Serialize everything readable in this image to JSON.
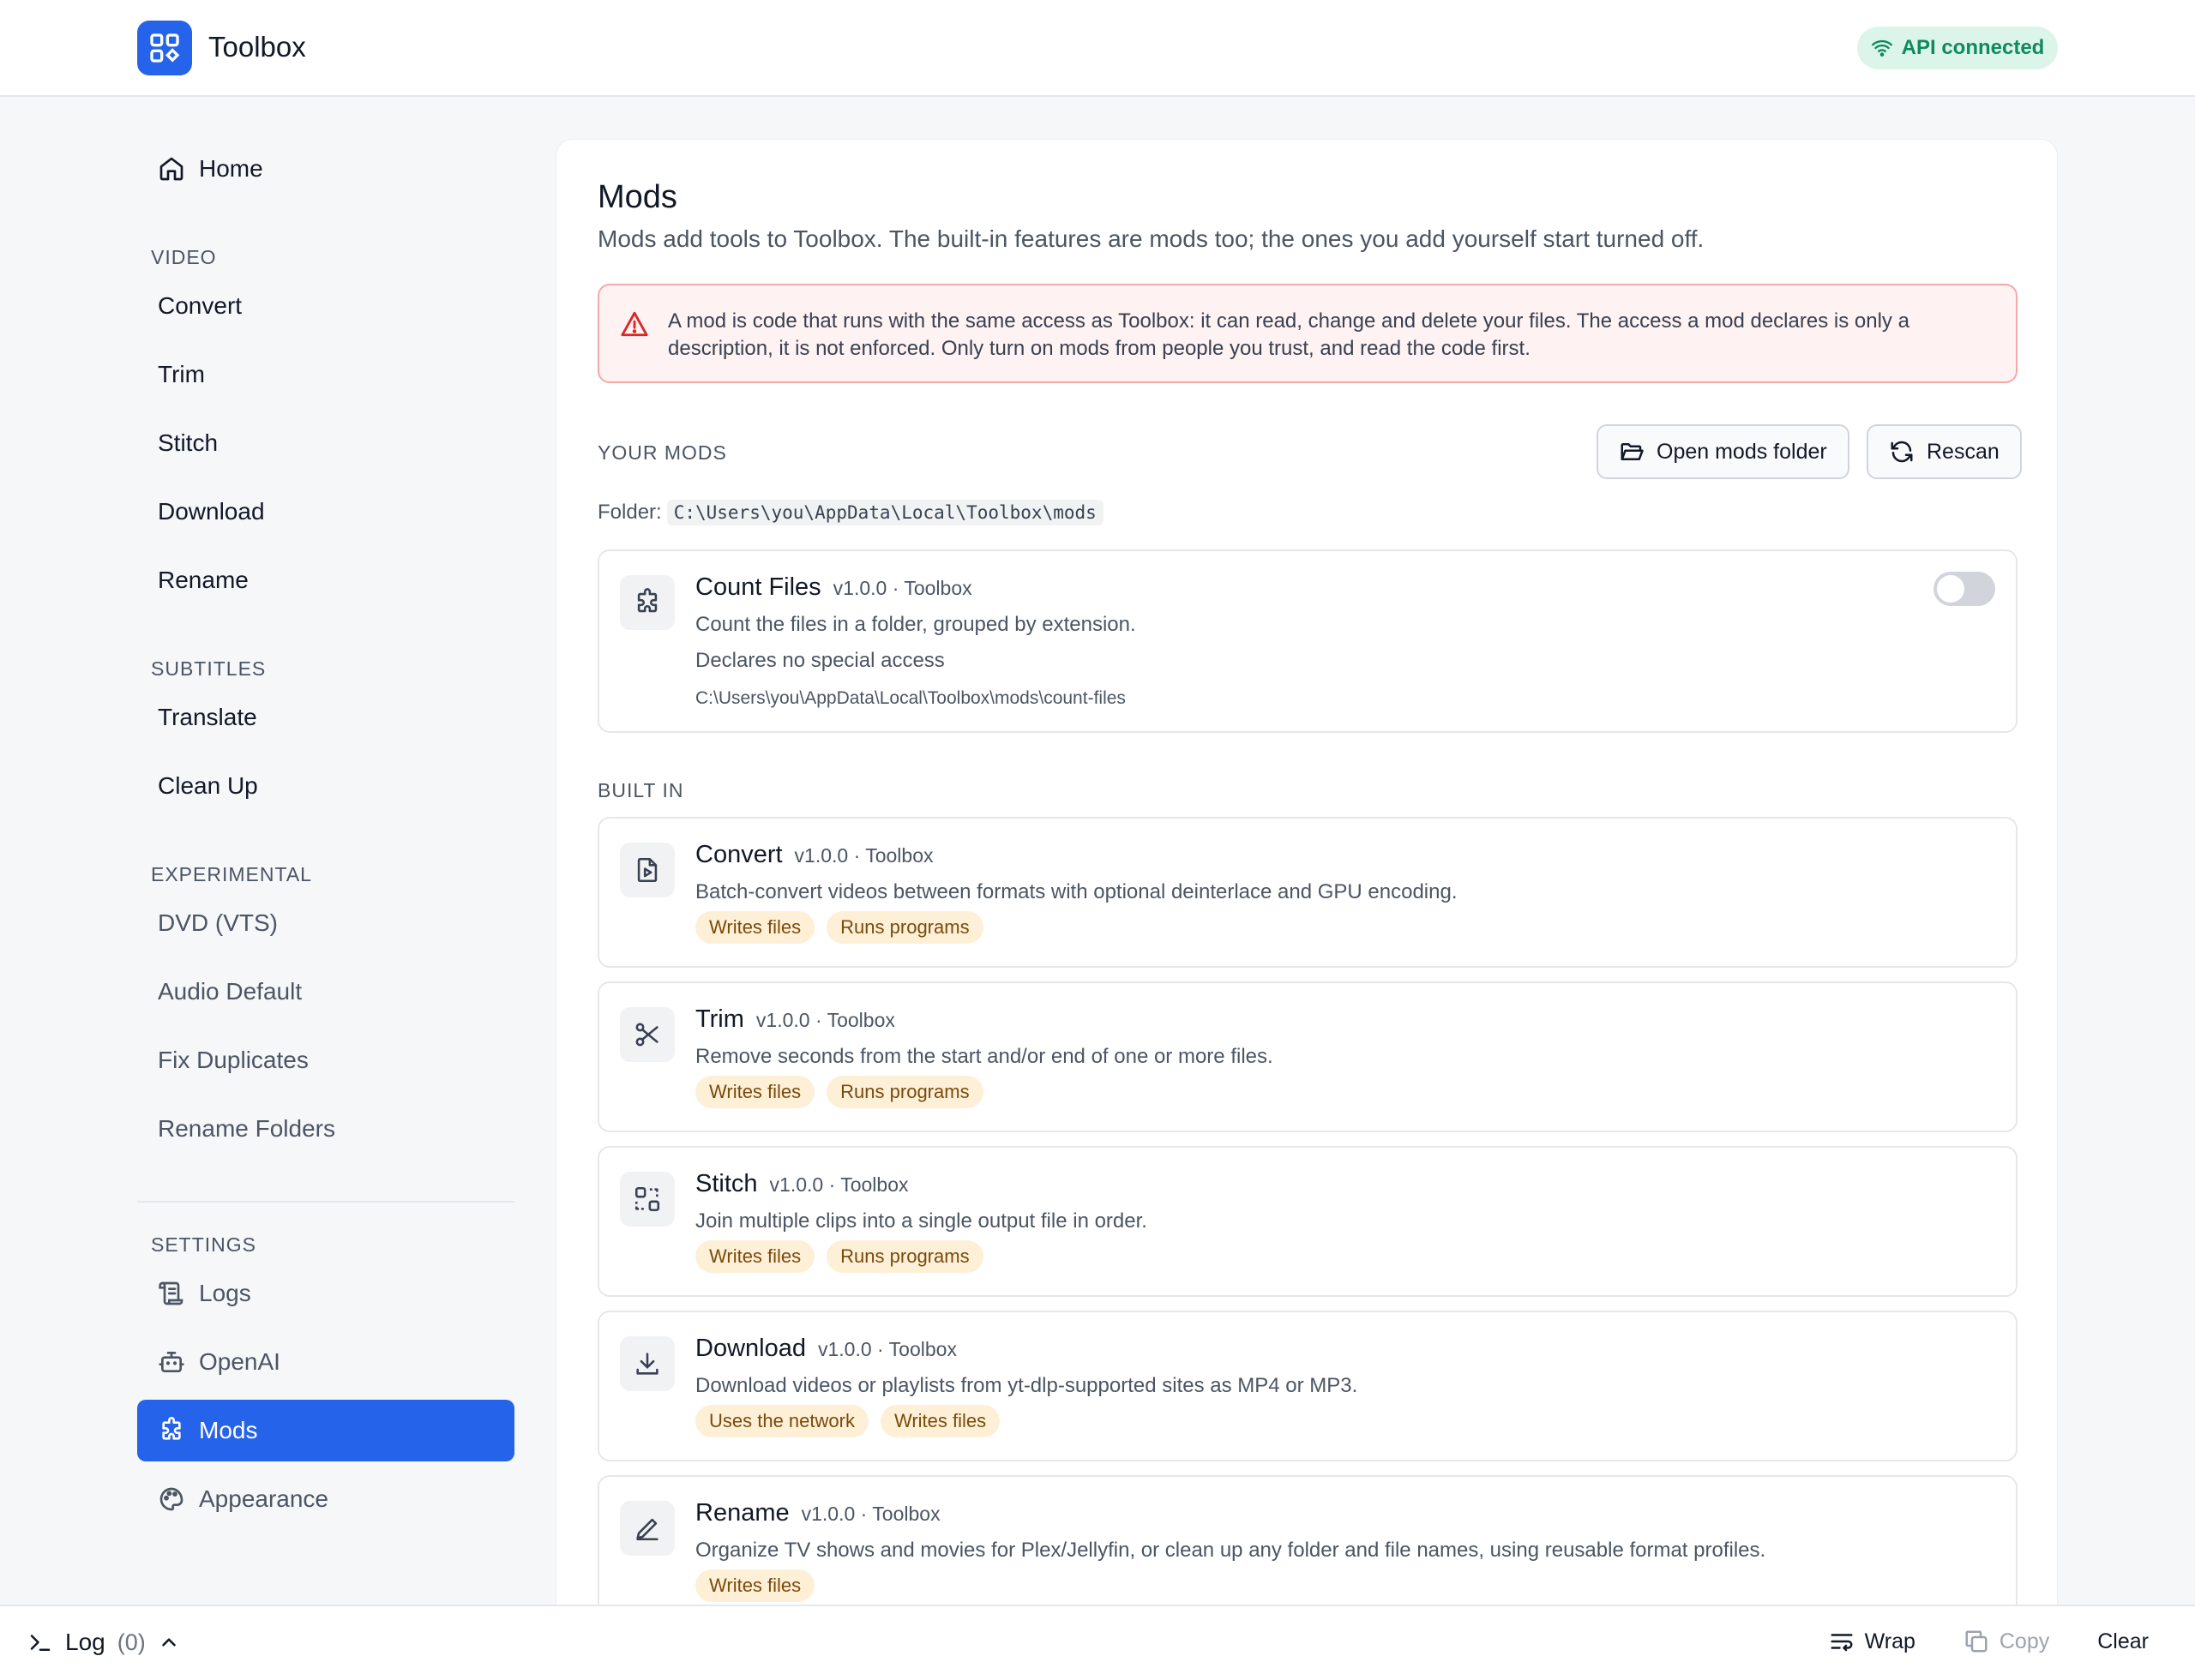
{
  "app": {
    "title": "Toolbox",
    "api_status": "API connected"
  },
  "sidebar": {
    "home": "Home",
    "sections": {
      "video": "VIDEO",
      "subtitles": "SUBTITLES",
      "experimental": "EXPERIMENTAL",
      "settings": "SETTINGS"
    },
    "video_items": [
      "Convert",
      "Trim",
      "Stitch",
      "Download",
      "Rename"
    ],
    "subtitle_items": [
      "Translate",
      "Clean Up"
    ],
    "experimental_items": [
      "DVD (VTS)",
      "Audio Default",
      "Fix Duplicates",
      "Rename Folders"
    ],
    "settings_items": [
      "Logs",
      "OpenAI",
      "Mods",
      "Appearance"
    ],
    "active_item": "Mods"
  },
  "main": {
    "title": "Mods",
    "subtitle": "Mods add tools to Toolbox. The built-in features are mods too; the ones you add yourself start turned off.",
    "warning": "A mod is code that runs with the same access as Toolbox: it can read, change and delete your files. The access a mod declares is only a description, it is not enforced. Only turn on mods from people you trust, and read the code first.",
    "your_mods_label": "YOUR MODS",
    "open_folder_button": "Open mods folder",
    "rescan_button": "Rescan",
    "folder_label": "Folder:",
    "folder_path": "C:\\Users\\you\\AppData\\Local\\Toolbox\\mods",
    "user_mods": [
      {
        "name": "Count Files",
        "meta": "v1.0.0 · Toolbox",
        "description": "Count the files in a folder, grouped by extension.",
        "access": "Declares no special access",
        "path": "C:\\Users\\you\\AppData\\Local\\Toolbox\\mods\\count-files",
        "enabled": false
      }
    ],
    "built_in_label": "BUILT IN",
    "built_in_mods": [
      {
        "name": "Convert",
        "meta": "v1.0.0 · Toolbox",
        "description": "Batch-convert videos between formats with optional deinterlace and GPU encoding.",
        "tags": [
          "Writes files",
          "Runs programs"
        ],
        "icon": "file-play-icon"
      },
      {
        "name": "Trim",
        "meta": "v1.0.0 · Toolbox",
        "description": "Remove seconds from the start and/or end of one or more files.",
        "tags": [
          "Writes files",
          "Runs programs"
        ],
        "icon": "scissors-icon"
      },
      {
        "name": "Stitch",
        "meta": "v1.0.0 · Toolbox",
        "description": "Join multiple clips into a single output file in order.",
        "tags": [
          "Writes files",
          "Runs programs"
        ],
        "icon": "stitch-icon"
      },
      {
        "name": "Download",
        "meta": "v1.0.0 · Toolbox",
        "description": "Download videos or playlists from yt-dlp-supported sites as MP4 or MP3.",
        "tags": [
          "Uses the network",
          "Writes files"
        ],
        "icon": "download-icon"
      },
      {
        "name": "Rename",
        "meta": "v1.0.0 · Toolbox",
        "description": "Organize TV shows and movies for Plex/Jellyfin, or clean up any folder and file names, using reusable format profiles.",
        "tags": [
          "Writes files"
        ],
        "icon": "pencil-icon"
      }
    ]
  },
  "logbar": {
    "label": "Log",
    "count": "(0)",
    "wrap": "Wrap",
    "copy": "Copy",
    "clear": "Clear"
  },
  "colors": {
    "accent": "#2563eb",
    "api_bg": "#dcf5ea",
    "api_fg": "#0f8a5f",
    "warning_bg": "#fef2f2",
    "warning_border": "#f4a9a9",
    "tag_bg": "#fdf0d7",
    "tag_fg": "#7a4a0a"
  }
}
